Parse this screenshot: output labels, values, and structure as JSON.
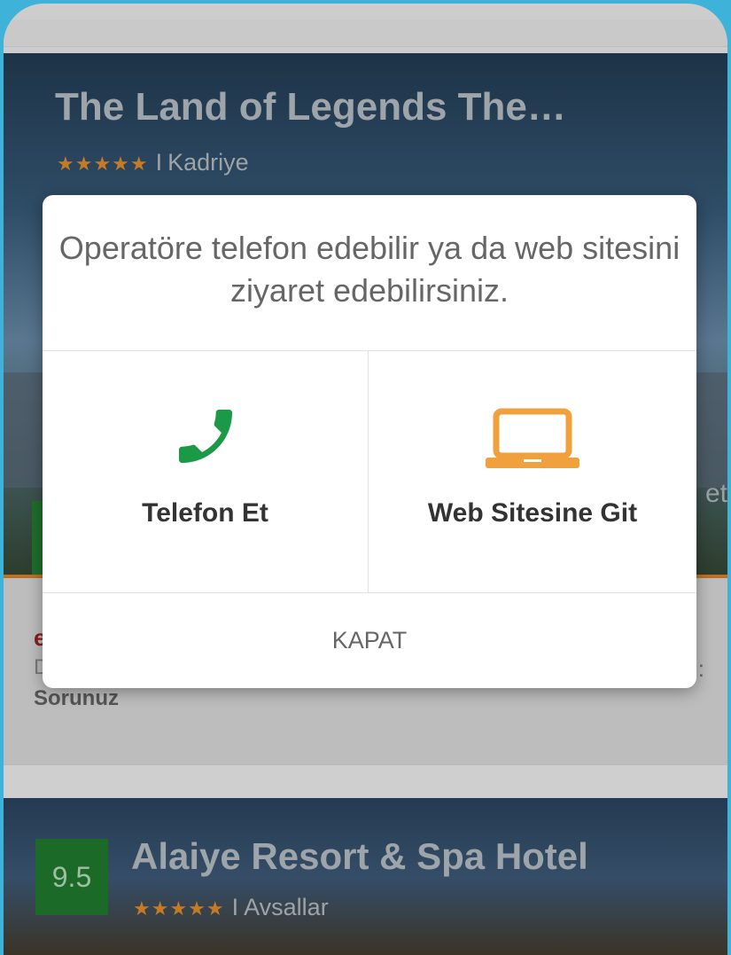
{
  "background_list": {
    "hotel1": {
      "title": "The Land of Legends The…",
      "stars": "★★★★★",
      "separator": "I",
      "location": "Kadriye"
    },
    "hotel2": {
      "rating": "9.5",
      "title": "Alaiye Resort & Spa Hotel",
      "stars": "★★★★★",
      "separator": "I",
      "location": "Avsallar"
    },
    "partial": {
      "side_text": "et",
      "red_letter": "e",
      "d_letter": "D",
      "sorunuz": "Sorunuz",
      "dots": ". :"
    }
  },
  "dialog": {
    "message": "Operatöre telefon edebilir ya da web sitesini ziyaret edebilirsiniz.",
    "phone_label": "Telefon Et",
    "web_label": "Web Sitesine Git",
    "close_label": "KAPAT"
  },
  "icons": {
    "phone": "phone-icon",
    "laptop": "laptop-icon"
  },
  "colors": {
    "phone_green": "#1a9a47",
    "laptop_orange": "#f0a03c",
    "page_bg": "#3fb2d9"
  }
}
